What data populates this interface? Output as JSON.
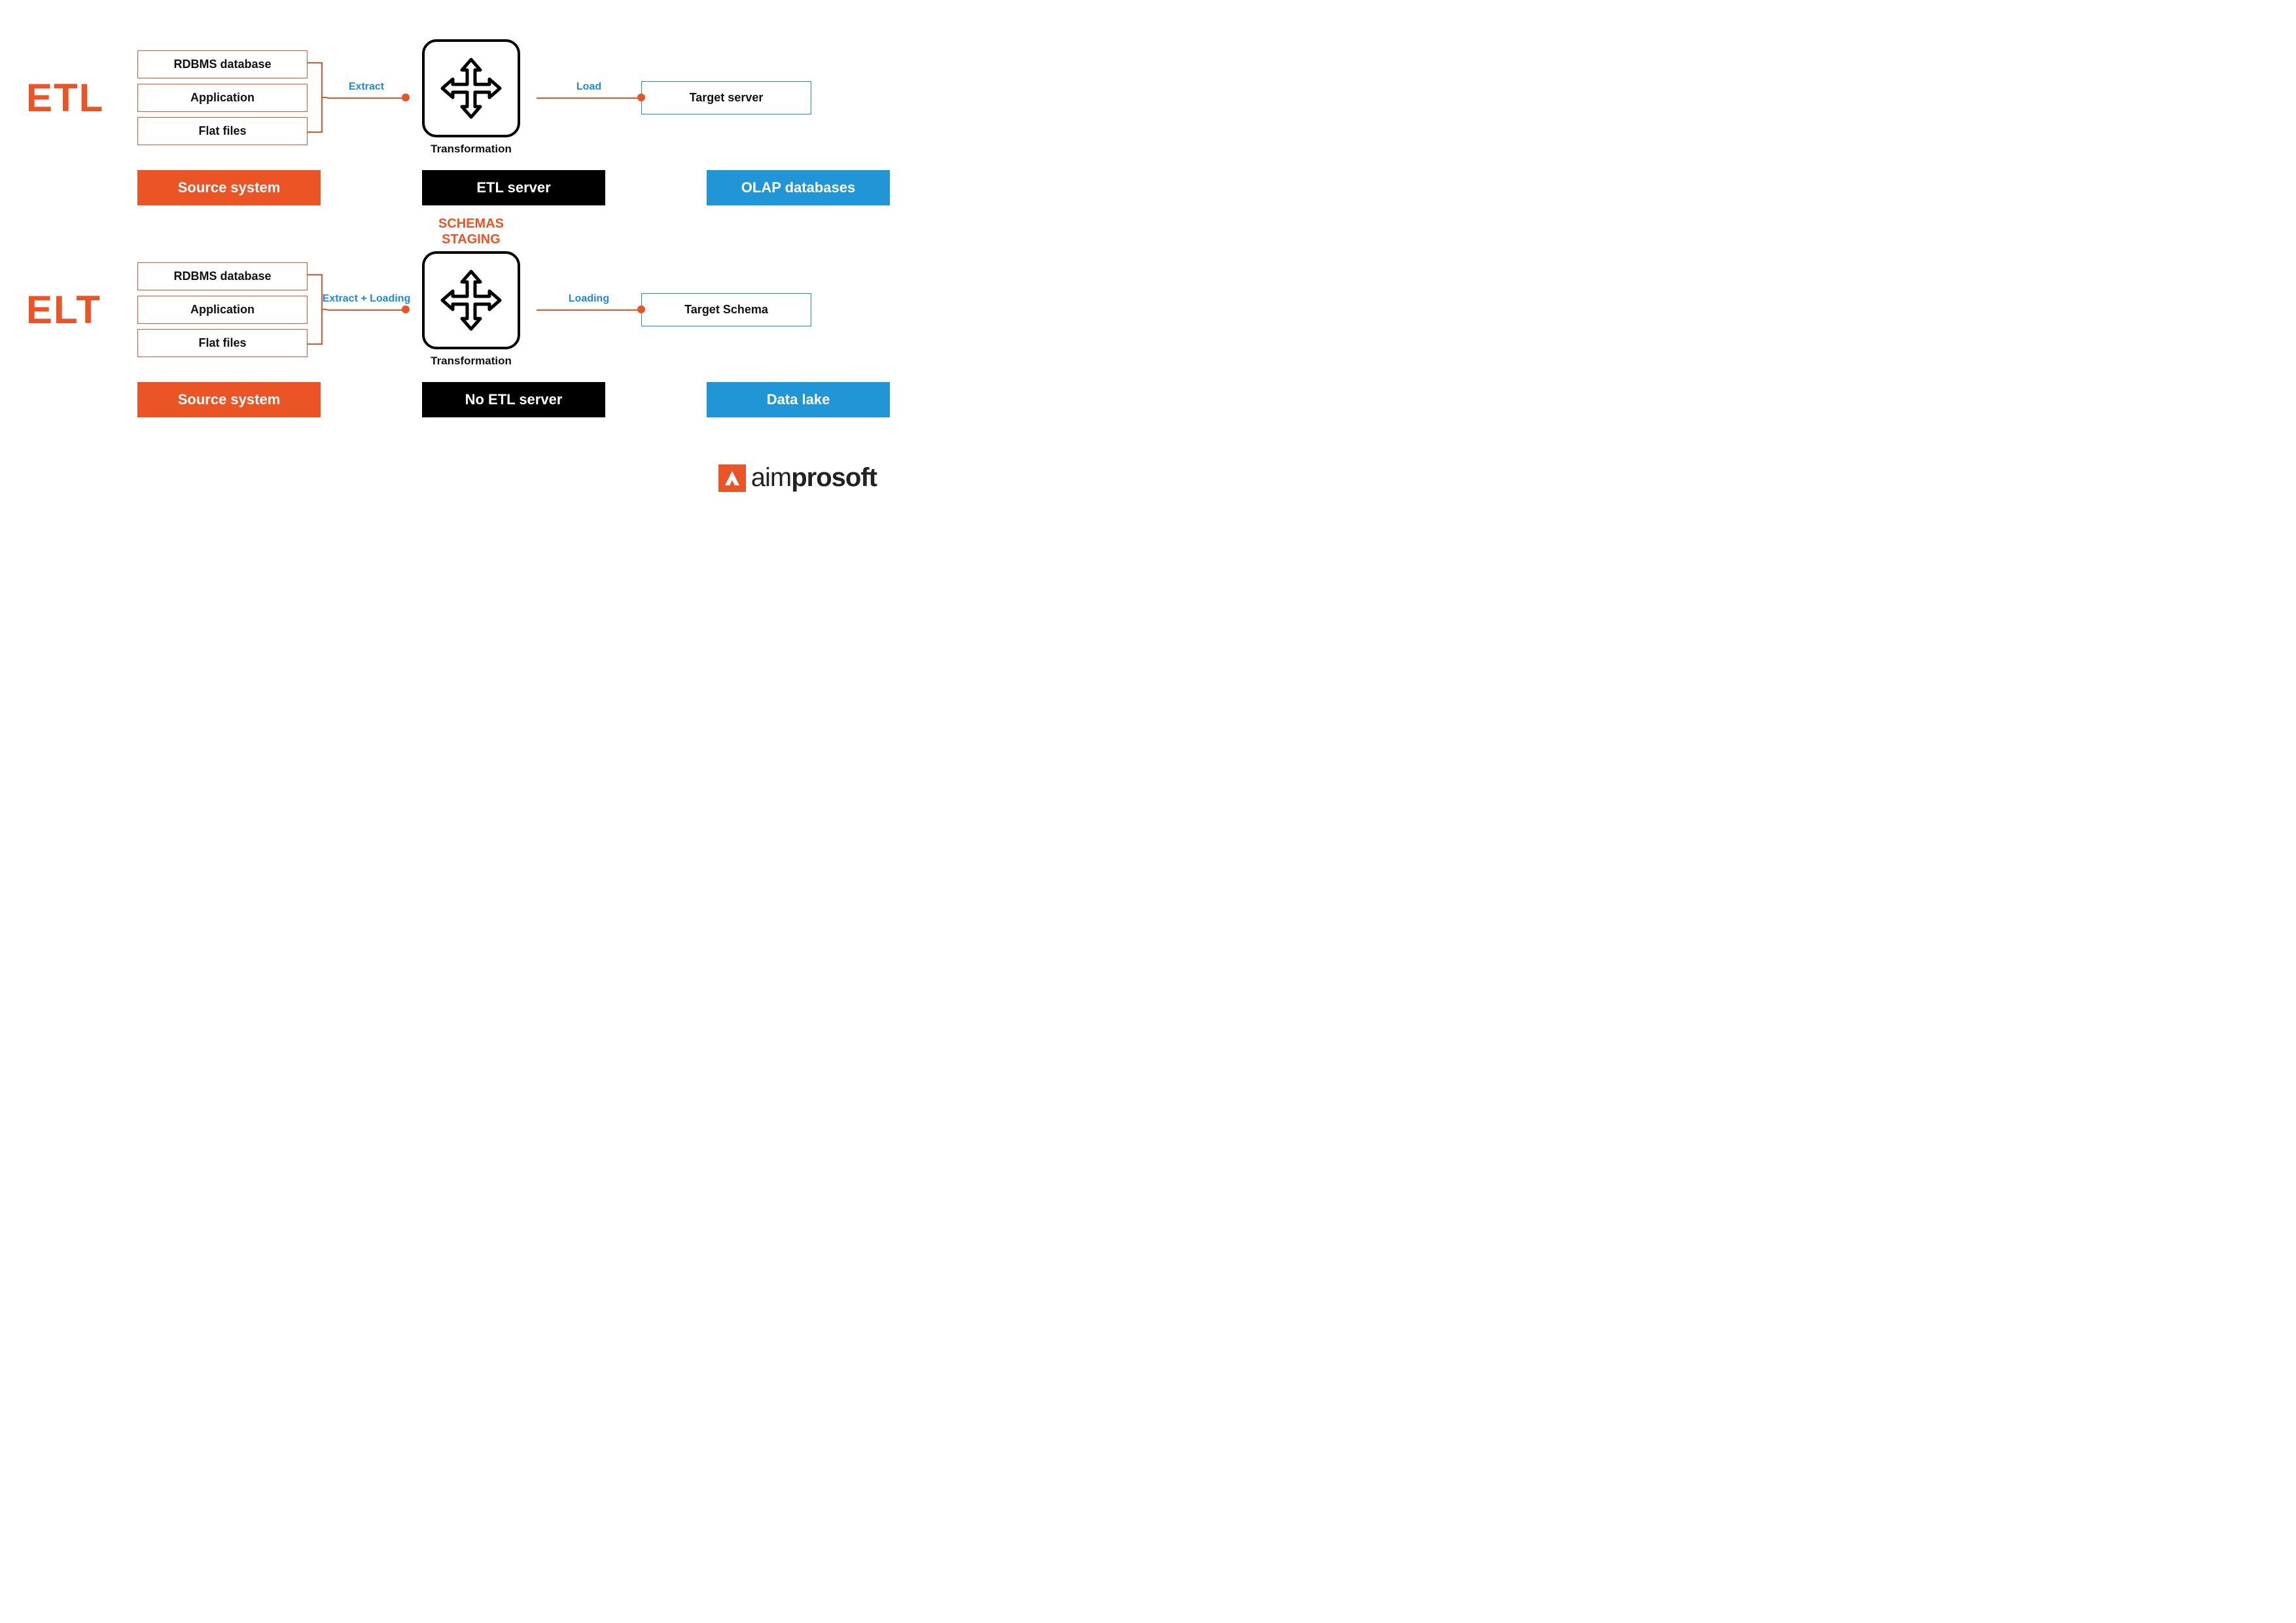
{
  "colors": {
    "orange": "#EB5424",
    "blue_text": "#1E88E5",
    "blue_fill": "#2196D6",
    "black": "#000000"
  },
  "etl": {
    "title": "ETL",
    "sources": [
      "RDBMS database",
      "Application",
      "Flat files"
    ],
    "conn1_label": "Extract",
    "center_sub": "Transformation",
    "conn2_label": "Load",
    "target": "Target server",
    "labels": {
      "left": "Source system",
      "center": "ETL server",
      "right": "OLAP databases"
    }
  },
  "elt": {
    "title": "ELT",
    "sources": [
      "RDBMS database",
      "Application",
      "Flat files"
    ],
    "conn1_label": "Extract + Loading",
    "center_header_line1": "SCHEMAS",
    "center_header_line2": "STAGING",
    "center_sub": "Transformation",
    "conn2_label": "Loading",
    "target": "Target Schema",
    "labels": {
      "left": "Source system",
      "center": "No ETL server",
      "right": "Data lake"
    }
  },
  "logo": {
    "pre": "aim",
    "bold": "prosoft"
  }
}
